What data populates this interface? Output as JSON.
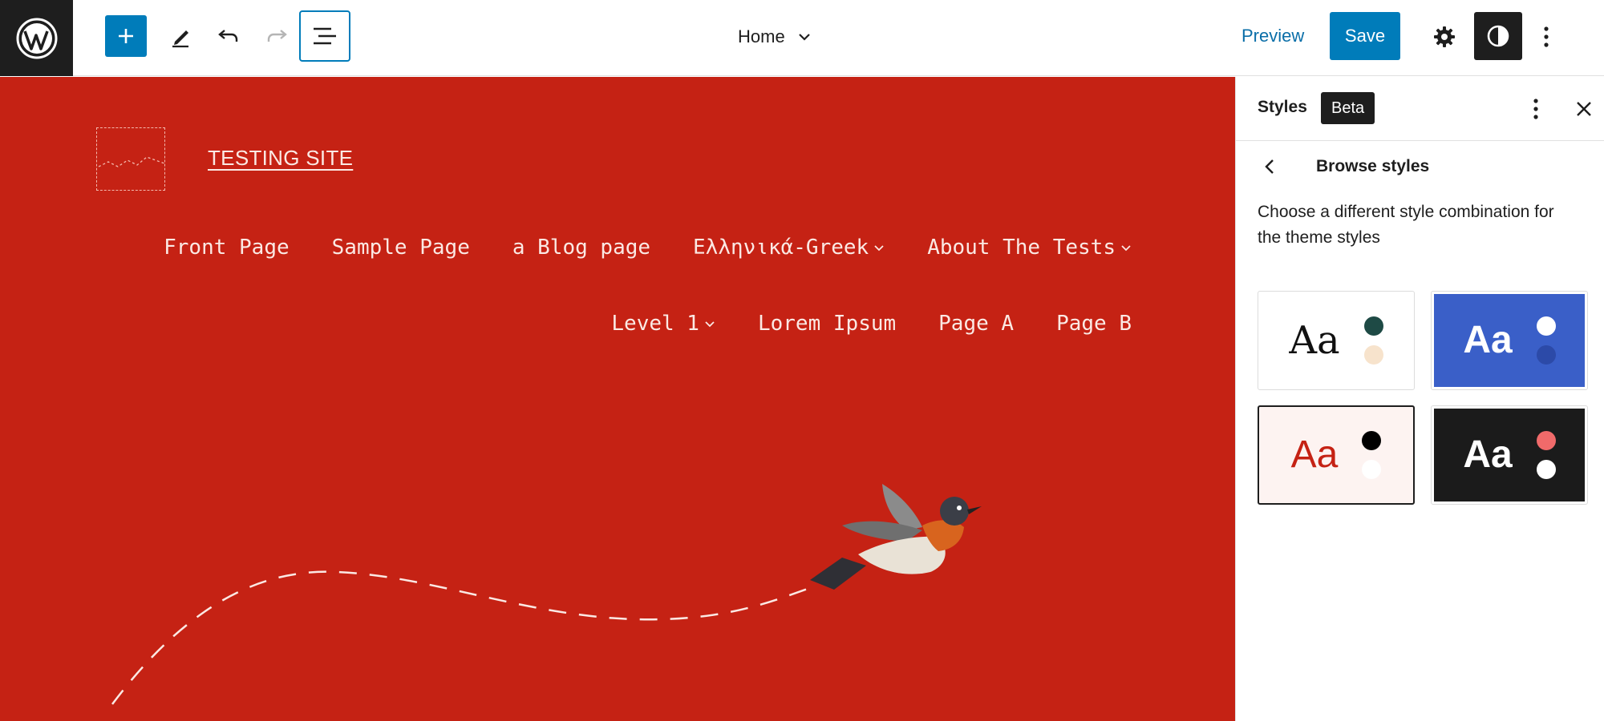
{
  "toolbar": {
    "document_title": "Home",
    "preview_label": "Preview",
    "save_label": "Save",
    "icons": [
      "wordpress-logo-icon",
      "plus-icon",
      "pencil-icon",
      "undo-icon",
      "redo-icon",
      "list-view-icon",
      "chevron-down-icon",
      "gear-icon",
      "contrast-icon",
      "more-vertical-icon"
    ]
  },
  "canvas": {
    "site_title": "TESTING SITE",
    "background_color": "#c52214",
    "nav_row_1": [
      {
        "label": "Front Page",
        "has_submenu": false
      },
      {
        "label": "Sample Page",
        "has_submenu": false
      },
      {
        "label": "a Blog page",
        "has_submenu": false
      },
      {
        "label": "Ελληνικά-Greek",
        "has_submenu": true
      },
      {
        "label": "About The Tests",
        "has_submenu": true
      }
    ],
    "nav_row_2": [
      {
        "label": "Level 1",
        "has_submenu": true
      },
      {
        "label": "Lorem Ipsum",
        "has_submenu": false
      },
      {
        "label": "Page A",
        "has_submenu": false
      },
      {
        "label": "Page B",
        "has_submenu": false
      }
    ]
  },
  "sidebar": {
    "title": "Styles",
    "badge": "Beta",
    "subtitle": "Browse styles",
    "description": "Choose a different style combination for the theme styles",
    "variations": [
      {
        "sample": "Aa",
        "background": "#ffffff",
        "colors": [
          "#1e4a45",
          "#f7e3cc"
        ],
        "selected": false
      },
      {
        "sample": "Aa",
        "background": "#3a5fc8",
        "colors": [
          "#ffffff",
          "#2c4aa8"
        ],
        "selected": false
      },
      {
        "sample": "Aa",
        "background": "#fdf3f1",
        "colors": [
          "#000000",
          "#ffffff"
        ],
        "selected": true
      },
      {
        "sample": "Aa",
        "background": "#1b1b1b",
        "colors": [
          "#f06a6a",
          "#ffffff"
        ],
        "selected": false
      }
    ]
  }
}
